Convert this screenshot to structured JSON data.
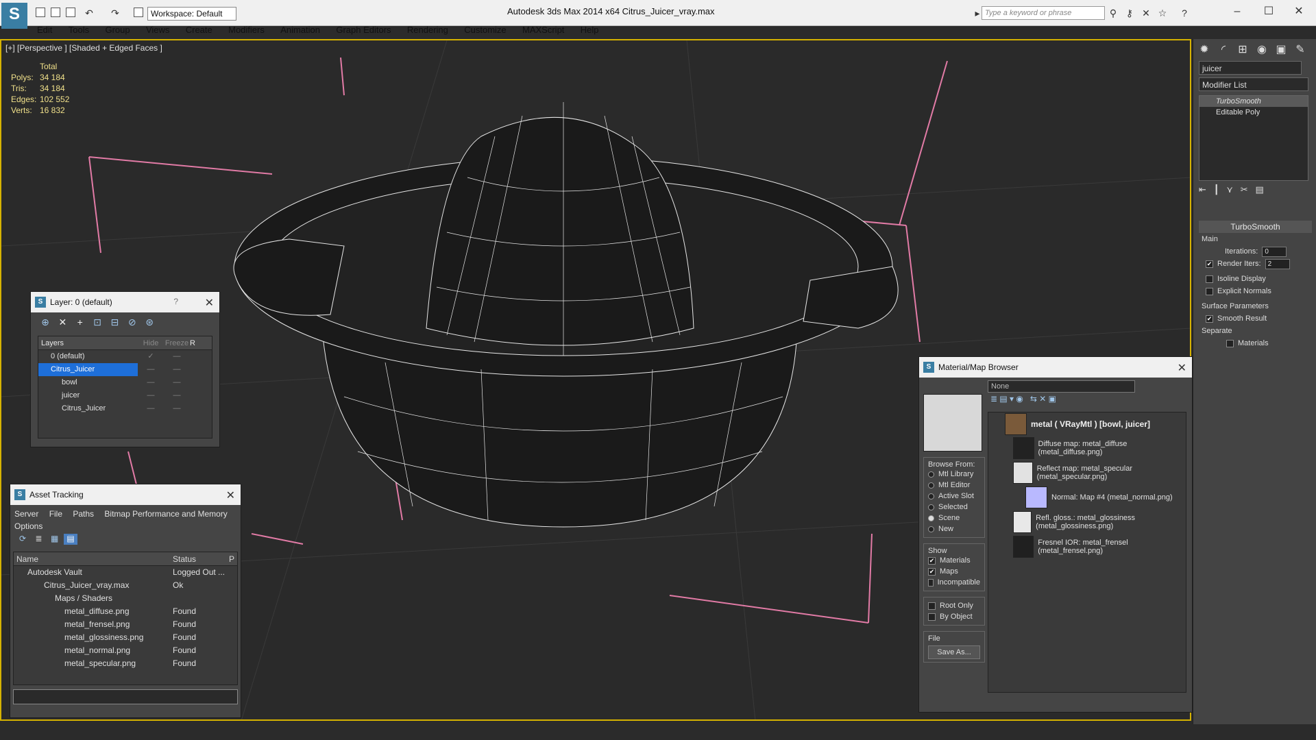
{
  "app": {
    "title": "Autodesk 3ds Max  2014 x64     Citrus_Juicer_vray.max",
    "workspace": "Workspace: Default",
    "search_placeholder": "Type a keyword or phrase"
  },
  "menu": [
    "Edit",
    "Tools",
    "Group",
    "Views",
    "Create",
    "Modifiers",
    "Animation",
    "Graph Editors",
    "Rendering",
    "Customize",
    "MAXScript",
    "Help"
  ],
  "viewport": {
    "label": "[+] [Perspective ] [Shaded + Edged Faces ]",
    "stats_header": "Total",
    "stats": [
      {
        "k": "Polys:",
        "v": "34 184"
      },
      {
        "k": "Tris:",
        "v": "34 184"
      },
      {
        "k": "Edges:",
        "v": "102 552"
      },
      {
        "k": "Verts:",
        "v": "16 832"
      }
    ]
  },
  "command_panel": {
    "object_name": "juicer",
    "modifier_list": "Modifier List",
    "stack": [
      "TurboSmooth",
      "Editable Poly"
    ],
    "turbosmooth": {
      "title": "TurboSmooth",
      "main": "Main",
      "iterations_label": "Iterations:",
      "iterations": "0",
      "render_iters_label": "Render Iters:",
      "render_iters": "2",
      "isoline": "Isoline Display",
      "explicit_normals": "Explicit Normals",
      "surface_params": "Surface Parameters",
      "smooth_result": "Smooth Result",
      "separate": "Separate",
      "materials": "Materials"
    }
  },
  "layer_dialog": {
    "title": "Layer: 0 (default)",
    "help": "?",
    "columns": [
      "Layers",
      "Hide",
      "Freeze",
      "R"
    ],
    "rows": [
      "0 (default)",
      "Citrus_Juicer",
      "bowl",
      "juicer",
      "Citrus_Juicer"
    ]
  },
  "asset_dialog": {
    "title": "Asset Tracking",
    "menu": [
      "Server",
      "File",
      "Paths",
      "Bitmap Performance and Memory",
      "Options"
    ],
    "columns": [
      "Name",
      "Status",
      "P"
    ],
    "rows": [
      {
        "name": "Autodesk Vault",
        "status": "Logged Out ..."
      },
      {
        "name": "Citrus_Juicer_vray.max",
        "status": "Ok"
      },
      {
        "name": "Maps / Shaders",
        "status": ""
      },
      {
        "name": "metal_diffuse.png",
        "status": "Found"
      },
      {
        "name": "metal_frensel.png",
        "status": "Found"
      },
      {
        "name": "metal_glossiness.png",
        "status": "Found"
      },
      {
        "name": "metal_normal.png",
        "status": "Found"
      },
      {
        "name": "metal_specular.png",
        "status": "Found"
      }
    ]
  },
  "material_browser": {
    "title": "Material/Map Browser",
    "search": "None",
    "browse_from": "Browse From:",
    "sources": [
      "Mtl Library",
      "Mtl Editor",
      "Active Slot",
      "Selected",
      "Scene",
      "New"
    ],
    "show": "Show",
    "show_items": [
      "Materials",
      "Maps",
      "Incompatible"
    ],
    "root_only": "Root Only",
    "by_object": "By Object",
    "file": "File",
    "save_as": "Save As...",
    "root": "metal ( VRayMtl ) [bowl, juicer]",
    "maps": [
      "Diffuse map: metal_diffuse (metal_diffuse.png)",
      "Reflect map: metal_specular (metal_specular.png)",
      "Normal: Map #4 (metal_normal.png)",
      "Refl. gloss.: metal_glossiness (metal_glossiness.png)",
      "Fresnel IOR: metal_frensel (metal_frensel.png)"
    ]
  }
}
